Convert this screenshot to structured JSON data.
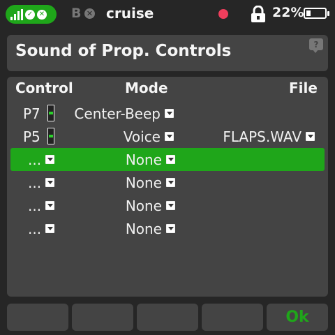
{
  "status": {
    "model_prefix": "B",
    "model_name": "cruise",
    "battery_percent": "22%",
    "battery_level": 0.22,
    "signal_icon": "signal-bars-icon",
    "accent_color": "#1fa61a",
    "record_color": "#ef3e5c"
  },
  "page": {
    "title": "Sound of Prop. Controls"
  },
  "table": {
    "headers": {
      "control": "Control",
      "mode": "Mode",
      "file": "File"
    },
    "rows": [
      {
        "control": "P7",
        "mode": "Center-Beep",
        "file": "",
        "gauge_level": 0.5
      },
      {
        "control": "P5",
        "mode": "Voice",
        "file": "FLAPS.WAV",
        "gauge_level": 0.5
      },
      {
        "control": "...",
        "mode": "None",
        "file": "",
        "selected": true
      },
      {
        "control": "...",
        "mode": "None",
        "file": ""
      },
      {
        "control": "...",
        "mode": "None",
        "file": ""
      },
      {
        "control": "...",
        "mode": "None",
        "file": ""
      }
    ]
  },
  "footer": {
    "ok_label": "Ok"
  }
}
